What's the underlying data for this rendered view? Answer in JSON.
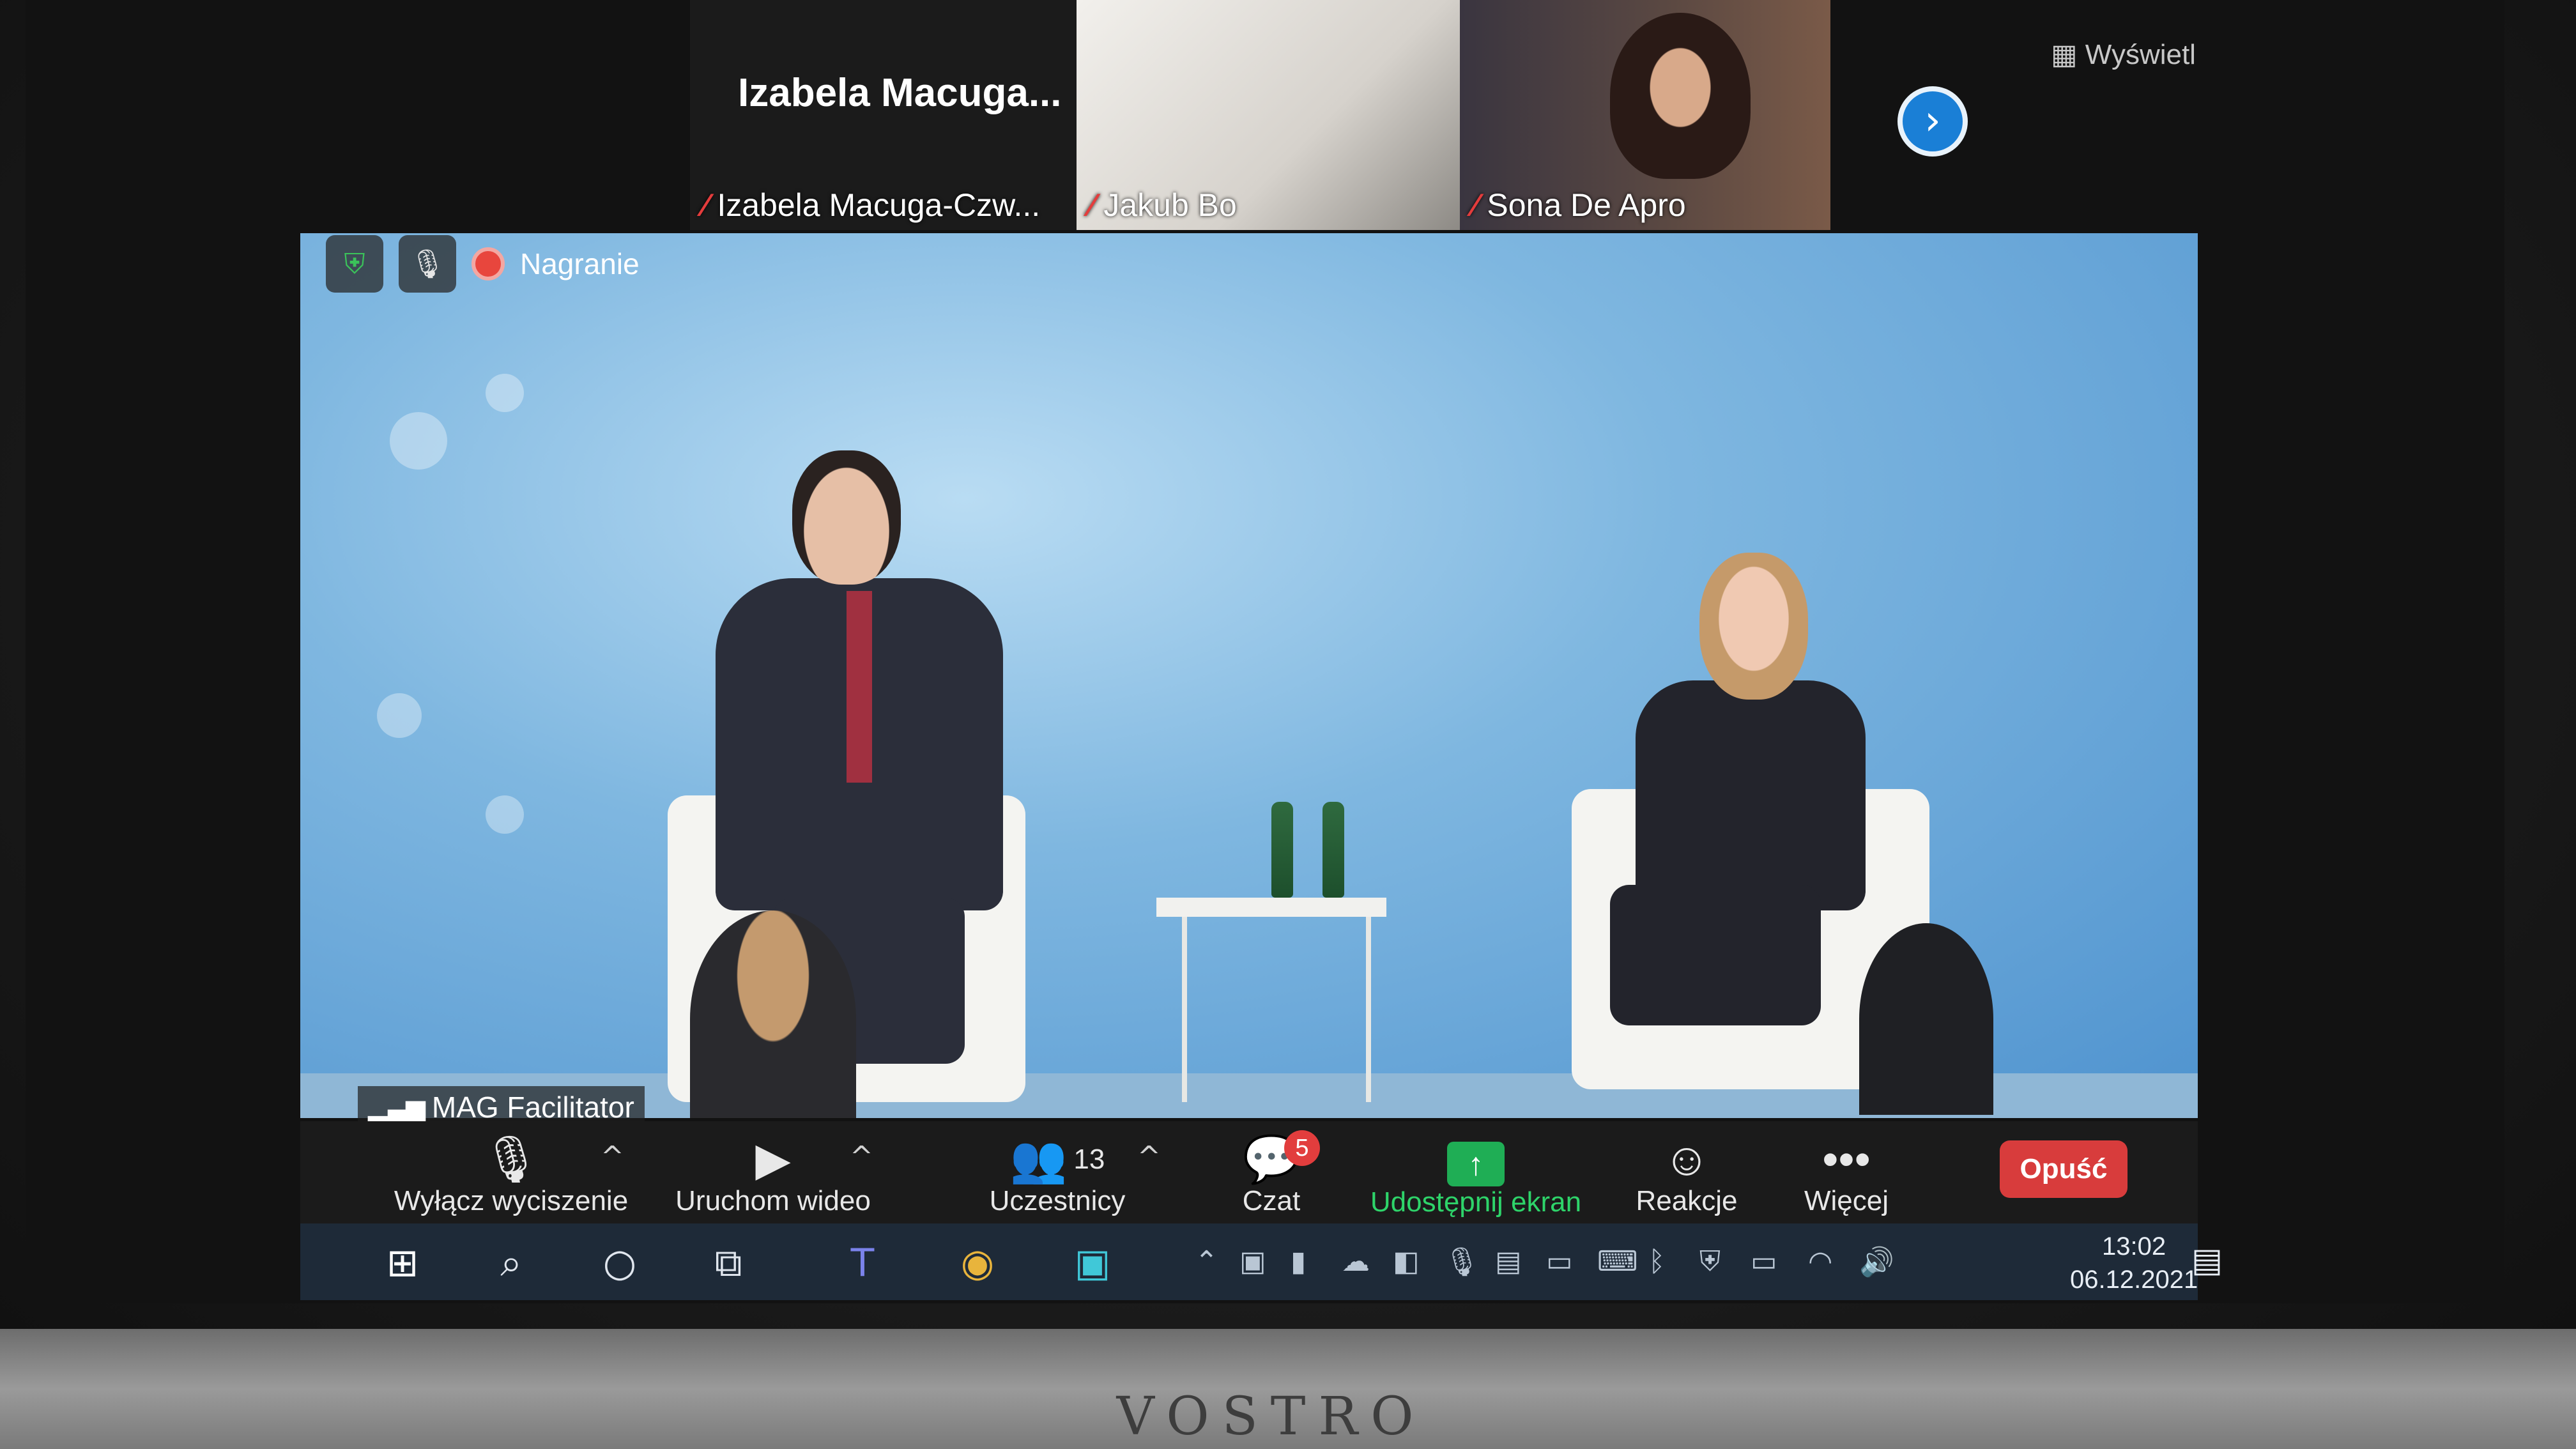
{
  "participants": {
    "tiles": [
      {
        "big_name": "Izabela  Macuga...",
        "name": "Izabela Macuga-Czw...",
        "muted": true
      },
      {
        "name": "Jakub Bo",
        "muted": true
      },
      {
        "name": "Sona De Apro",
        "muted": true
      }
    ],
    "next_icon": "chevron-right-icon",
    "view_label": "Wyświetl"
  },
  "recording": {
    "label": "Nagranie"
  },
  "main_video": {
    "speaker_label": "MAG Facilitator"
  },
  "toolbar": {
    "mute_label": "Wyłącz wyciszenie",
    "video_label": "Uruchom wideo",
    "participants_label": "Uczestnicy",
    "participants_count": "13",
    "chat_label": "Czat",
    "chat_badge": "5",
    "share_label": "Udostępnij ekran",
    "reactions_label": "Reakcje",
    "more_label": "Więcej",
    "leave_label": "Opuść",
    "share_color": "#2ed46a",
    "leave_color": "#d83c3c"
  },
  "taskbar": {
    "time": "13:02",
    "date": "06.12.2021"
  },
  "laptop": {
    "brand": "VOSTRO"
  }
}
